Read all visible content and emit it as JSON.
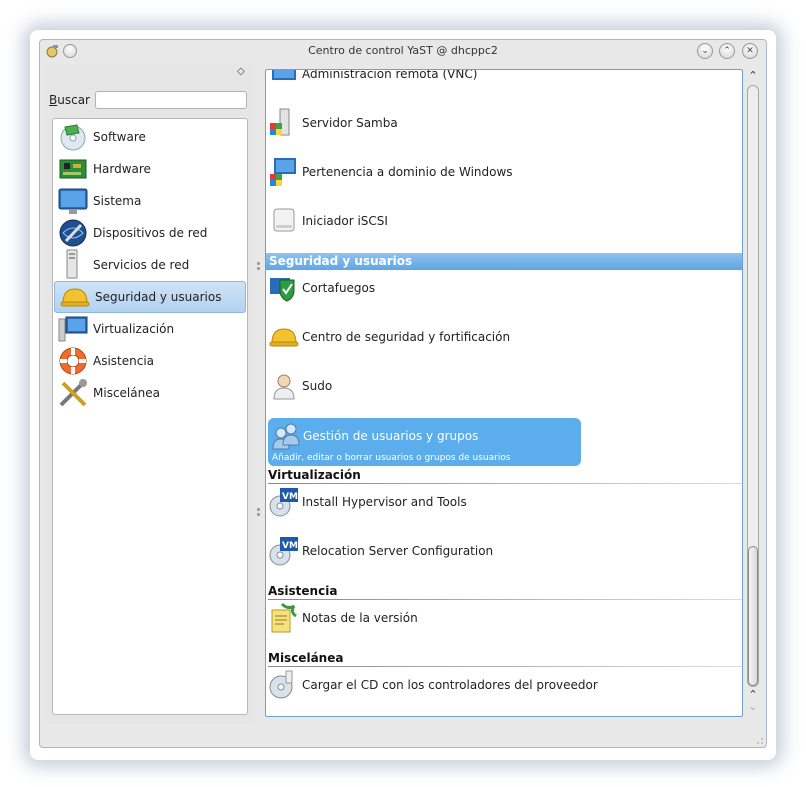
{
  "window": {
    "title": "Centro de control YaST @ dhcppc2",
    "collapse_glyph": "◇",
    "buttons": {
      "minimize": "⌄",
      "maximize": "⌃",
      "close": "✕"
    }
  },
  "search": {
    "label": "Buscar",
    "value": "",
    "placeholder": ""
  },
  "categories": [
    {
      "label": "Software",
      "icon": "software-disc-icon",
      "selected": false
    },
    {
      "label": "Hardware",
      "icon": "circuit-board-icon",
      "selected": false
    },
    {
      "label": "Sistema",
      "icon": "monitor-icon",
      "selected": false
    },
    {
      "label": "Dispositivos de red",
      "icon": "network-globe-icon",
      "selected": false
    },
    {
      "label": "Servicios de red",
      "icon": "server-tower-icon",
      "selected": false
    },
    {
      "label": "Seguridad y usuarios",
      "icon": "hard-hat-icon",
      "selected": true
    },
    {
      "label": "Virtualización",
      "icon": "virtual-monitor-icon",
      "selected": false
    },
    {
      "label": "Asistencia",
      "icon": "lifebuoy-icon",
      "selected": false
    },
    {
      "label": "Miscelánea",
      "icon": "tools-icon",
      "selected": false
    }
  ],
  "modules": {
    "vnc": "Administración remota (VNC)",
    "samba": "Servidor Samba",
    "windows_domain": "Pertenencia a dominio de Windows",
    "iscsi": "Iniciador iSCSI",
    "security_header": "Seguridad y usuarios",
    "firewall": "Cortafuegos",
    "hardening": "Centro de seguridad y fortificación",
    "sudo": "Sudo",
    "users": "Gestión de usuarios y grupos",
    "users_desc": "Añadir, editar o borrar usuarios o grupos de usuarios",
    "virt_header": "Virtualización",
    "hypervisor": "Install Hypervisor and Tools",
    "relocation": "Relocation Server Configuration",
    "support_header": "Asistencia",
    "release_notes": "Notas de la versión",
    "misc_header": "Miscelánea",
    "vendor_cd": "Cargar el CD con los controladores del proveedor"
  },
  "colors": {
    "selection": "#5badec",
    "section_bar": "#6aaee9",
    "pane_border": "#6ea0d6"
  },
  "scrollbar": {
    "up": "⌃",
    "down": "⌃",
    "down2": "⌄"
  }
}
